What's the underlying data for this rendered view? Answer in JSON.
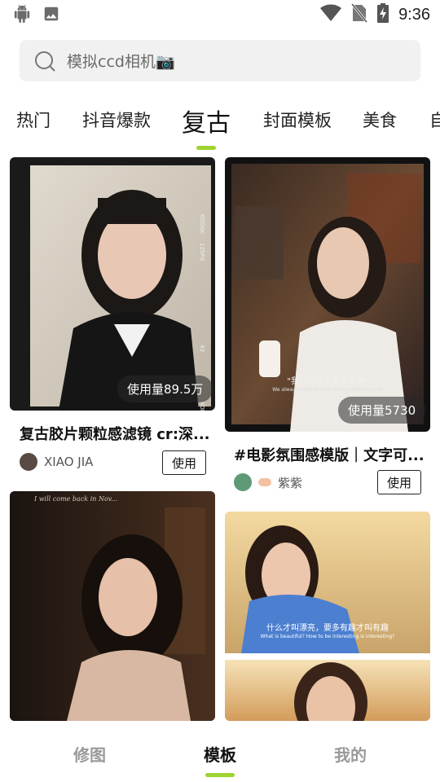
{
  "status_bar": {
    "time": "9:36"
  },
  "search": {
    "text": "模拟ccd相机📷"
  },
  "tabs": [
    {
      "label": "热门"
    },
    {
      "label": "抖音爆款"
    },
    {
      "label": "复古"
    },
    {
      "label": "封面模板"
    },
    {
      "label": "美食"
    },
    {
      "label": "自"
    }
  ],
  "cards": [
    {
      "title": "复古胶片颗粒感滤镜 cr:深...",
      "usage": "使用量89.5万",
      "author": "XIAO JIA",
      "button": "使用"
    },
    {
      "title": "#电影氛围感模版｜文字可...",
      "usage": "使用量5730",
      "author": "紫紫",
      "button": "使用",
      "image_caption": "\"我们总以为来日方长\"",
      "image_caption_sub": "We always think there is a long time to come"
    },
    {
      "image_text": "I will come back in Nov..."
    },
    {
      "image_caption": "什么才叫漂亮，要多有趣才叫有趣",
      "image_caption_sub": "What is beautiful? How to be interesting is interesting?"
    }
  ],
  "bottom_nav": {
    "items": [
      {
        "label": "修图"
      },
      {
        "label": "模板"
      },
      {
        "label": "我的"
      }
    ],
    "active": "模板"
  },
  "colors": {
    "accent": "#9ed332"
  }
}
